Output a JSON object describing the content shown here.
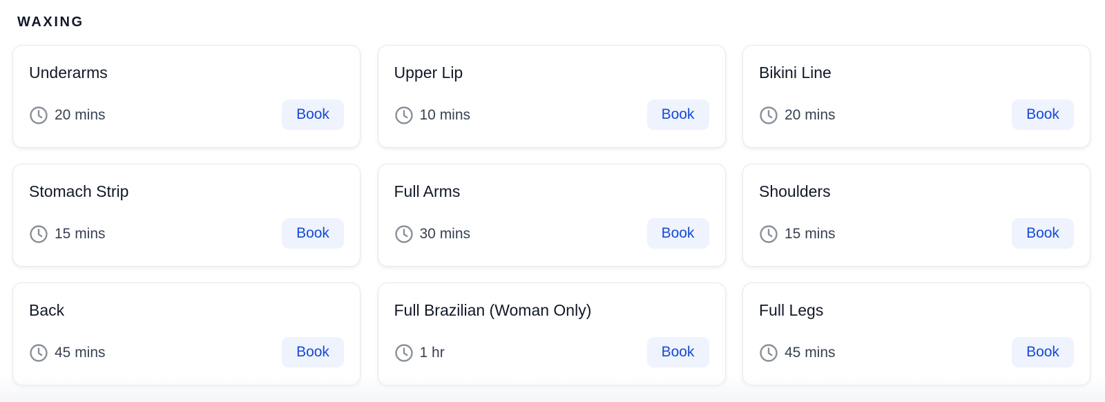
{
  "section": {
    "title": "WAXING"
  },
  "services": [
    {
      "name": "Underarms",
      "duration": "20 mins",
      "button": "Book"
    },
    {
      "name": "Upper Lip",
      "duration": "10 mins",
      "button": "Book"
    },
    {
      "name": "Bikini Line",
      "duration": "20 mins",
      "button": "Book"
    },
    {
      "name": "Stomach Strip",
      "duration": "15 mins",
      "button": "Book"
    },
    {
      "name": "Full Arms",
      "duration": "30 mins",
      "button": "Book"
    },
    {
      "name": "Shoulders",
      "duration": "15 mins",
      "button": "Book"
    },
    {
      "name": "Back",
      "duration": "45 mins",
      "button": "Book"
    },
    {
      "name": "Full Brazilian (Woman Only)",
      "duration": "1 hr",
      "button": "Book"
    },
    {
      "name": "Full Legs",
      "duration": "45 mins",
      "button": "Book"
    }
  ],
  "icons": {
    "duration": "clock-icon"
  },
  "colors": {
    "text": "#111827",
    "muted_text": "#374151",
    "border": "#e7e9ed",
    "button_background": "#eef3fd",
    "button_text": "#1749d6",
    "icon": "#8a9099"
  }
}
